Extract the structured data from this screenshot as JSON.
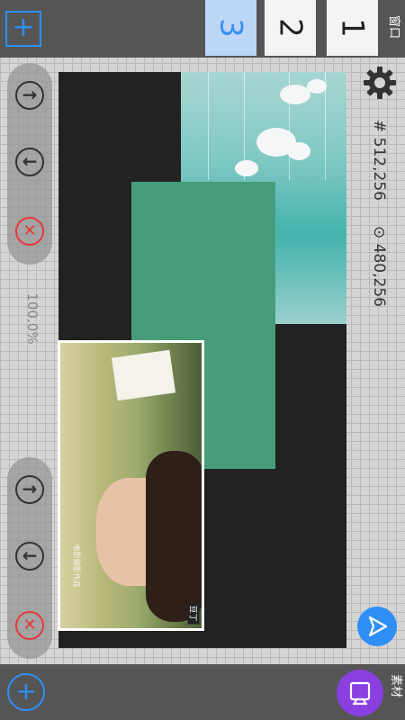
{
  "top_bar": {
    "add_button": "+",
    "tabs": [
      {
        "label": "3",
        "selected": true
      },
      {
        "label": "2",
        "selected": false
      },
      {
        "label": "1",
        "selected": false
      }
    ],
    "window_label": "窗口"
  },
  "info": {
    "size": "# 512,256",
    "position": "⊙ 480,256"
  },
  "zoom": "100.0%",
  "controls": {
    "next_icon": "→",
    "prev_icon": "←",
    "delete_icon": "✕"
  },
  "photo": {
    "watermark": "电影摄影作品",
    "tag": "豆丁"
  },
  "bottom_bar": {
    "add_button": "+",
    "material_label": "素材"
  },
  "colors": {
    "accent": "#2f8ff7",
    "delete": "#e6393b",
    "material": "#8a3fe0",
    "green_layer": "#479c7a"
  },
  "icons": [
    "add-icon",
    "settings-gear-icon",
    "arrow-right-icon",
    "arrow-left-icon",
    "close-icon",
    "send-icon",
    "material-icon"
  ]
}
